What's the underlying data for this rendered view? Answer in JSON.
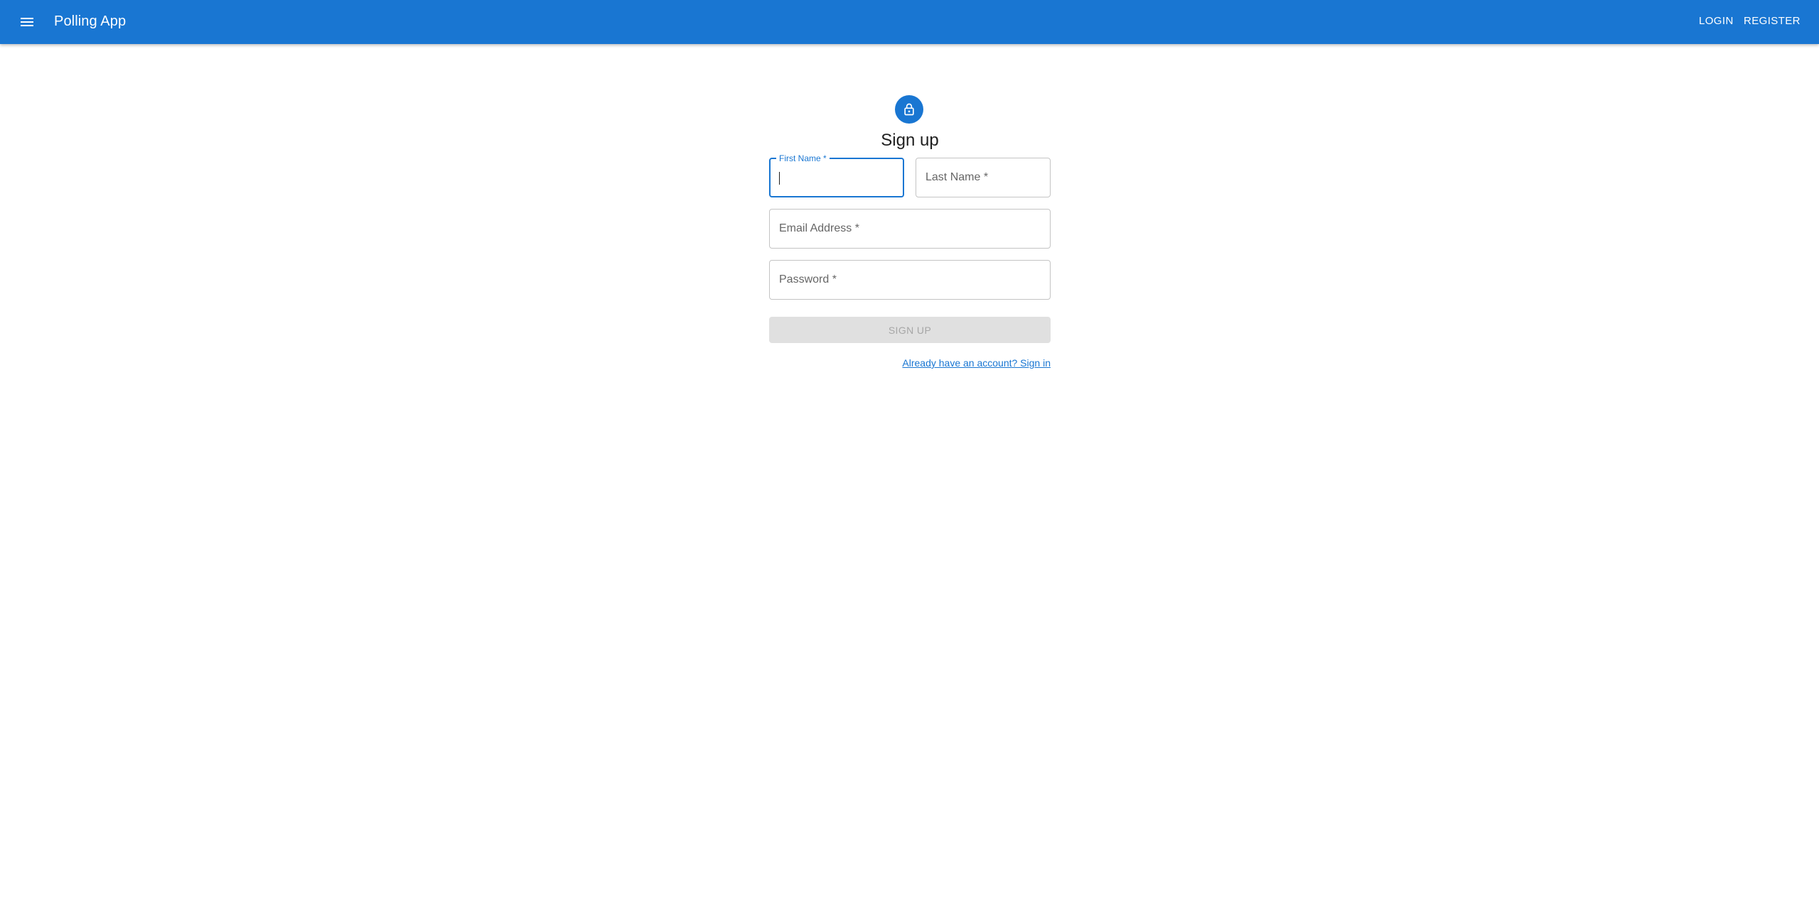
{
  "appbar": {
    "title": "Polling App",
    "menu_icon": "hamburger-menu-icon",
    "nav": {
      "login_label": "LOGIN",
      "register_label": "REGISTER"
    },
    "color": "#1976d2"
  },
  "form": {
    "avatar_icon": "lock-icon",
    "heading": "Sign up",
    "fields": {
      "first_name": {
        "label": "First Name *",
        "value": ""
      },
      "last_name": {
        "label": "Last Name *",
        "value": ""
      },
      "email": {
        "label": "Email Address *",
        "value": ""
      },
      "password": {
        "label": "Password *",
        "value": ""
      }
    },
    "submit_label": "SIGN UP",
    "signin_link": "Already have an account? Sign in"
  }
}
